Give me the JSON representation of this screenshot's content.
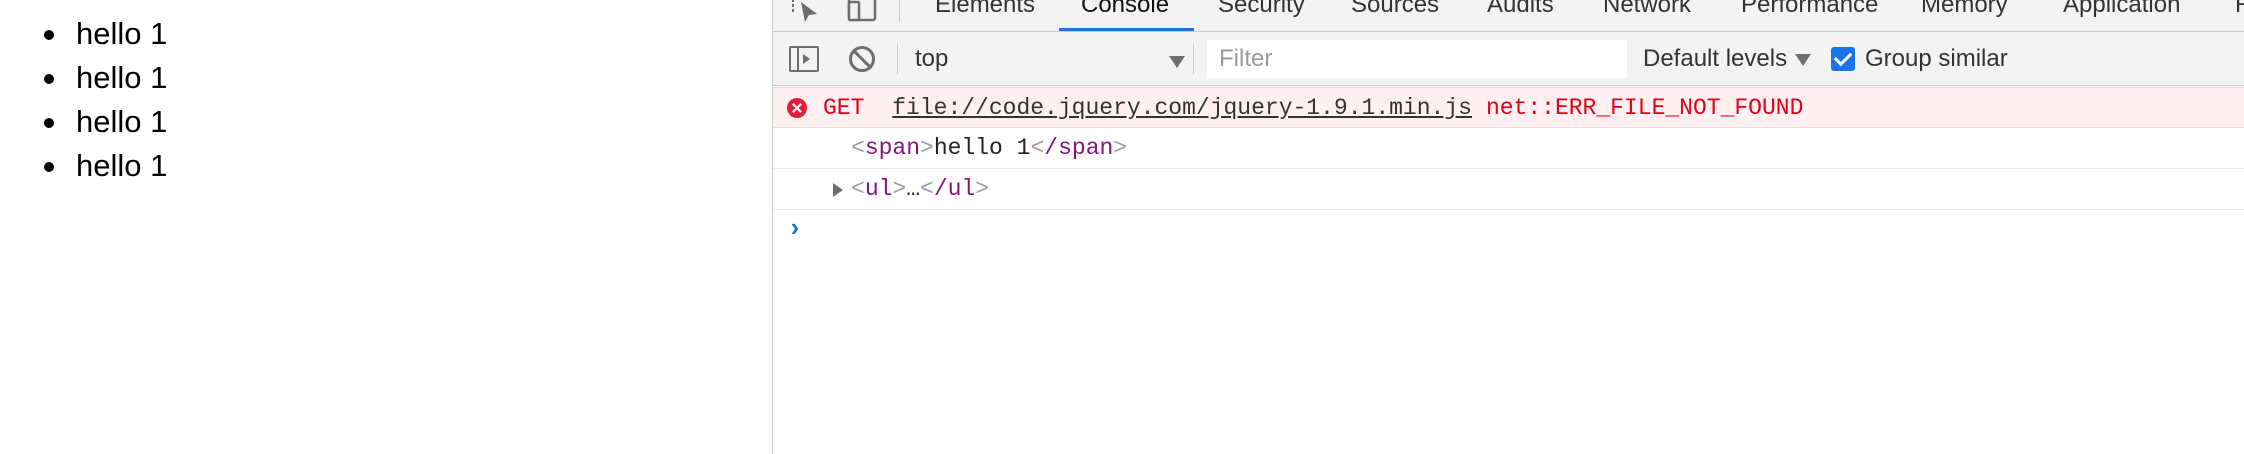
{
  "page": {
    "list_items": [
      "hello 1",
      "hello 1",
      "hello 1",
      "hello 1"
    ]
  },
  "devtools": {
    "tabs": [
      {
        "label": "Elements",
        "active": false
      },
      {
        "label": "Console",
        "active": true
      },
      {
        "label": "Security",
        "active": false
      },
      {
        "label": "Sources",
        "active": false
      },
      {
        "label": "Audits",
        "active": false
      },
      {
        "label": "Network",
        "active": false
      },
      {
        "label": "Performance",
        "active": false
      },
      {
        "label": "Memory",
        "active": false
      },
      {
        "label": "Application",
        "active": false
      },
      {
        "label": "R",
        "active": false
      }
    ],
    "toolbar": {
      "context": "top",
      "filter_placeholder": "Filter",
      "levels_label": "Default levels",
      "group_similar_label": "Group similar",
      "group_similar_checked": true
    },
    "messages": {
      "error": {
        "method": "GET",
        "url": "file://code.jquery.com/jquery-1.9.1.min.js",
        "message": "net::ERR_FILE_NOT_FOUND"
      },
      "span_log": {
        "open_tag": "span",
        "text": "hello 1",
        "close_tag": "/span"
      },
      "ul_log": {
        "open_tag": "ul",
        "ellipsis": "…",
        "close_tag": "/ul"
      }
    },
    "prompt_symbol": "›",
    "colors": {
      "accent": "#1a73e8",
      "error_text": "#e0001a",
      "error_bg": "#fef0f0",
      "tag": "#881280"
    }
  }
}
